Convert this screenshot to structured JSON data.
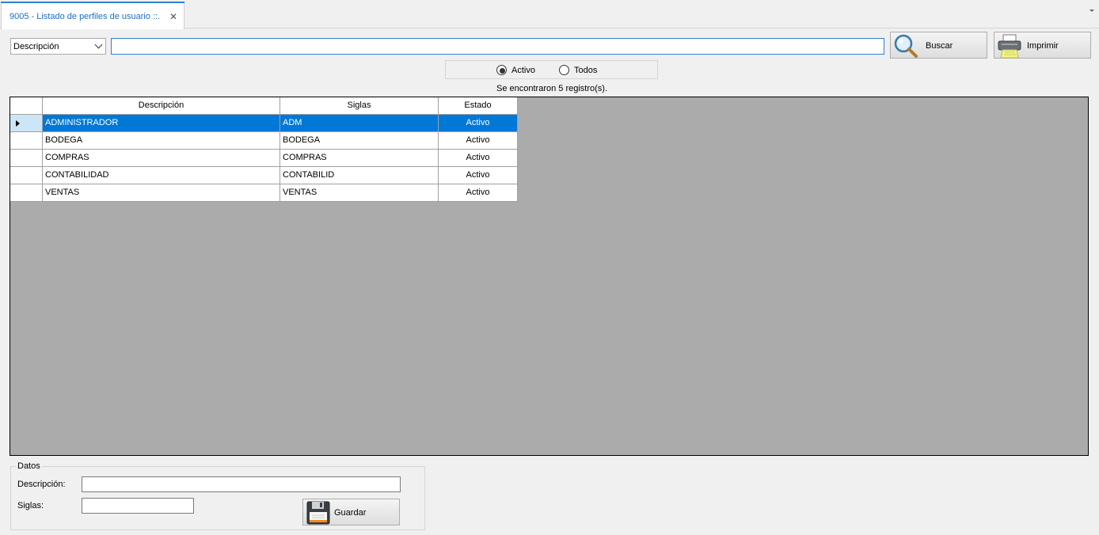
{
  "tab": {
    "title": "9005 - Listado de perfiles de usuario ::."
  },
  "search": {
    "field_selected": "Descripción",
    "query": "",
    "buscar_label": "Buscar",
    "imprimir_label": "Imprimir"
  },
  "filter": {
    "activo_label": "Activo",
    "todos_label": "Todos",
    "selected": "Activo"
  },
  "status": {
    "count_text": "Se encontraron 5 registro(s)."
  },
  "grid": {
    "columns": [
      "Descripción",
      "Siglas",
      "Estado"
    ],
    "rows": [
      {
        "descripcion": "ADMINISTRADOR",
        "siglas": "ADM",
        "estado": "Activo"
      },
      {
        "descripcion": "BODEGA",
        "siglas": "BODEGA",
        "estado": "Activo"
      },
      {
        "descripcion": "COMPRAS",
        "siglas": "COMPRAS",
        "estado": "Activo"
      },
      {
        "descripcion": "CONTABILIDAD",
        "siglas": "CONTABILID",
        "estado": "Activo"
      },
      {
        "descripcion": "VENTAS",
        "siglas": "VENTAS",
        "estado": "Activo"
      }
    ],
    "selected_row": 0
  },
  "datos": {
    "legend": "Datos",
    "descripcion_label": "Descripción:",
    "descripcion_value": "",
    "siglas_label": "Siglas:",
    "siglas_value": "",
    "guardar_label": "Guardar"
  },
  "colors": {
    "accent": "#0078d7",
    "grid_background": "#ababab",
    "window_background": "#f0f0f0"
  }
}
